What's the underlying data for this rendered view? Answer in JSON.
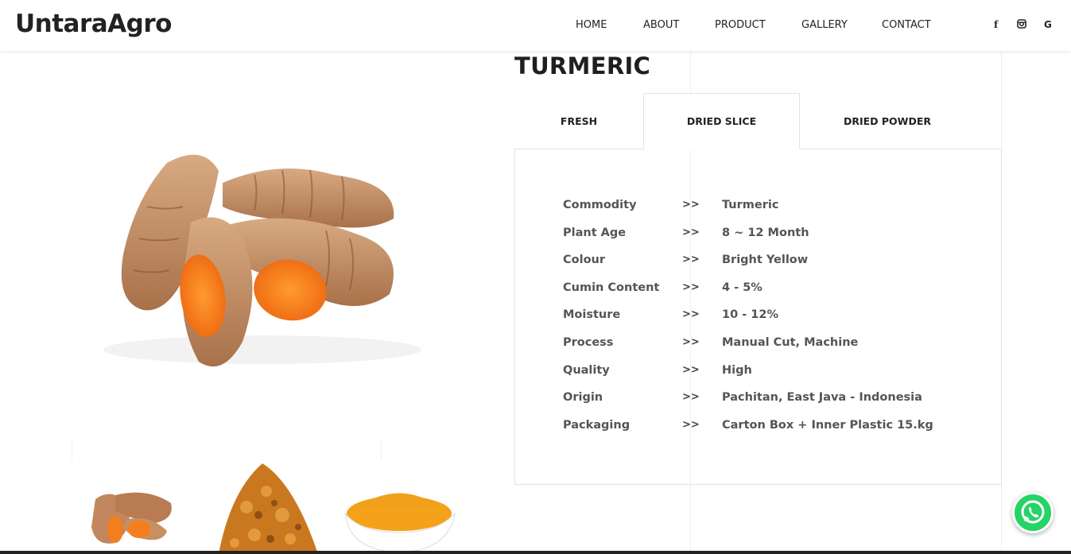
{
  "brand": {
    "logo": "UntaraAgro"
  },
  "nav": {
    "items": [
      "HOME",
      "ABOUT",
      "PRODUCT",
      "GALLERY",
      "CONTACT"
    ]
  },
  "social": {
    "facebook": "f",
    "instagram": "◘",
    "google": "G"
  },
  "product": {
    "title": "TURMERIC",
    "tabs": [
      {
        "label": "FRESH"
      },
      {
        "label": "DRIED SLICE",
        "active": true
      },
      {
        "label": "DRIED POWDER"
      }
    ],
    "separator": ">>",
    "specs": [
      {
        "label": "Commodity",
        "value": "Turmeric"
      },
      {
        "label": "Plant Age",
        "value": "8 ~ 12 Month"
      },
      {
        "label": "Colour",
        "value": "Bright Yellow"
      },
      {
        "label": "Cumin Content",
        "value": "4 - 5%"
      },
      {
        "label": "Moisture",
        "value": "10 - 12%"
      },
      {
        "label": "Process",
        "value": "Manual Cut, Machine"
      },
      {
        "label": "Quality",
        "value": "High"
      },
      {
        "label": "Origin",
        "value": "Pachitan, East Java - Indonesia"
      },
      {
        "label": "Packaging",
        "value": "Carton Box + Inner Plastic 15.kg"
      }
    ]
  },
  "colors": {
    "turmeric_skin": "#c9966b",
    "turmeric_flesh": "#f47d1e",
    "whatsapp": "#25d366",
    "text": "#555555"
  },
  "icons": [
    "facebook-icon",
    "instagram-icon",
    "google-icon",
    "whatsapp-icon"
  ]
}
